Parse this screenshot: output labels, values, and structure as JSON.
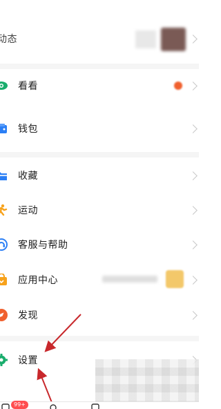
{
  "menu": {
    "dongtai": {
      "label": "动态"
    },
    "kankan": {
      "label": "看看"
    },
    "qianbao": {
      "label": "钱包"
    },
    "shoucang": {
      "label": "收藏"
    },
    "yundong": {
      "label": "运动"
    },
    "kefu": {
      "label": "客服与帮助"
    },
    "yingyong": {
      "label": "应用中心"
    },
    "faxian": {
      "label": "发现"
    },
    "shezhi": {
      "label": "设置"
    }
  },
  "tabbar": {
    "badge": "99+"
  },
  "colors": {
    "kankan_icon": "#1aad6d",
    "wallet_icon": "#2b7ff5",
    "favorite_icon": "#2b7ff5",
    "sport_icon": "#f7a21b",
    "help_icon": "#2b7ff5",
    "app_center_icon": "#f7a21b",
    "discover_icon": "#f0602e",
    "settings_icon": "#1aad6d",
    "arrow": "#c8282c"
  },
  "icons": [
    "eye-icon",
    "wallet-icon",
    "folder-icon",
    "running-icon",
    "headset-icon",
    "bag-icon",
    "compass-icon",
    "gear-icon"
  ]
}
